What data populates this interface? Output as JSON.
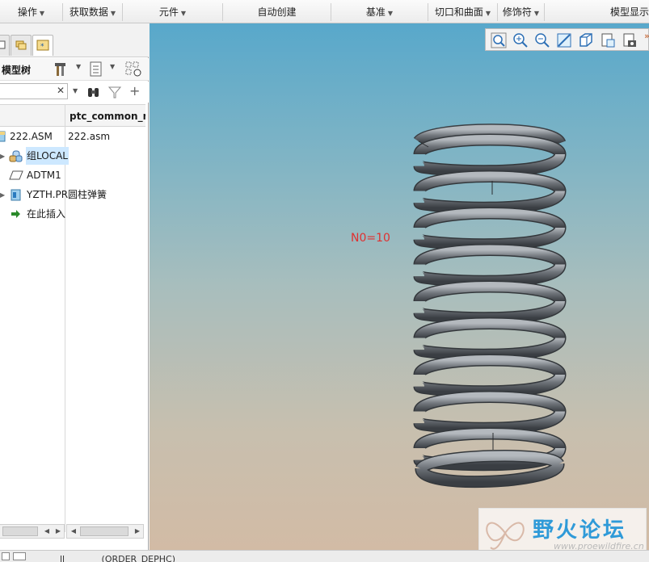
{
  "ribbon": {
    "groups": [
      {
        "label": "操作",
        "has_menu": true
      },
      {
        "label": "获取数据",
        "has_menu": true
      },
      {
        "label": "元件",
        "has_menu": true
      },
      {
        "label": "自动创建",
        "has_menu": false
      },
      {
        "label": "基准",
        "has_menu": true
      },
      {
        "label": "切口和曲面",
        "has_menu": true
      },
      {
        "label": "修饰符",
        "has_menu": true
      },
      {
        "label": "模型显示",
        "has_menu": false
      }
    ]
  },
  "left_panel": {
    "tabs": [
      {
        "icon": "model-tree-icon",
        "active": false
      },
      {
        "icon": "folder-browser-icon",
        "active": false
      },
      {
        "icon": "favorites-icon",
        "active": true
      }
    ],
    "tree_title": "模型树",
    "search": {
      "value": "",
      "placeholder": ""
    },
    "column_header": "ptc_common_n",
    "rows": [
      {
        "label": "222.ASM",
        "value": "222.asm",
        "icon": "assembly-icon",
        "expandable": false,
        "selected": false
      },
      {
        "label": "组LOCAL",
        "value": "",
        "icon": "group-icon",
        "expandable": true,
        "selected": true
      },
      {
        "label": "ADTM1",
        "value": "",
        "icon": "datum-plane-icon",
        "expandable": false,
        "selected": false
      },
      {
        "label": "YZTH.PR",
        "value": "圆柱弹簧",
        "icon": "part-icon",
        "expandable": true,
        "selected": false
      },
      {
        "label": "在此插入",
        "value": "",
        "icon": "insert-here-arrow-icon",
        "expandable": false,
        "selected": false
      }
    ]
  },
  "viewport": {
    "annotation": "N0=10",
    "annotation_color": "#e03030",
    "view_tools": [
      "refit-icon",
      "zoom-in-icon",
      "zoom-out-icon",
      "repaint-icon",
      "display-style-icon",
      "saved-views-icon",
      "view-manager-icon"
    ]
  },
  "watermark": {
    "text": "野火论坛",
    "url": "www.proewildfire.cn"
  },
  "statusbar": {
    "text": "        ll             (ORDER_DEPHC)"
  },
  "colors": {
    "spring": "#7c8186",
    "background_top": "#58a8cb",
    "background_bottom": "#d2bba5",
    "selection": "#cde8ff"
  }
}
